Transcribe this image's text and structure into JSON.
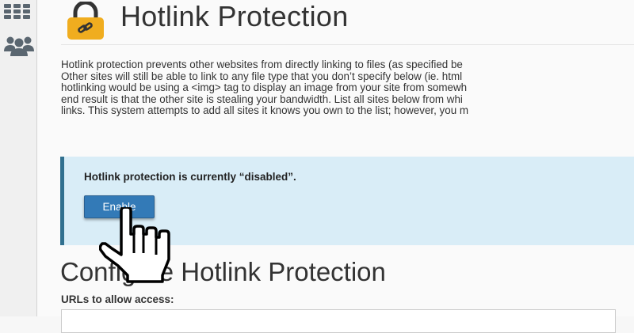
{
  "sidebar": {
    "icons": [
      "grid-icon",
      "users-icon"
    ]
  },
  "header": {
    "title": "Hotlink Protection",
    "icon": "lock-icon",
    "icon_color": "#f0ad1f"
  },
  "description": {
    "lines": [
      "Hotlink protection prevents other websites from directly linking to files (as specified be",
      "Other sites will still be able to link to any file type that you don’t specify below (ie. html",
      "hotlinking would be using a <img> tag to display an image from your site from somewh",
      "end result is that the other site is stealing your bandwidth. List all sites below from whi",
      "links. This system attempts to add all sites it knows you own to the list; however, you m"
    ]
  },
  "status_alert": {
    "message": "Hotlink protection is currently “disabled”.",
    "background": "#d9edf7",
    "border_color": "#31708f"
  },
  "enable_button": {
    "label": "Enable",
    "color": "#337ab7"
  },
  "configure_section": {
    "heading": "Configure Hotlink Protection",
    "urls_label": "URLs to allow access:",
    "urls_value": ""
  },
  "cursor": {
    "icon": "hand-pointer-icon"
  }
}
